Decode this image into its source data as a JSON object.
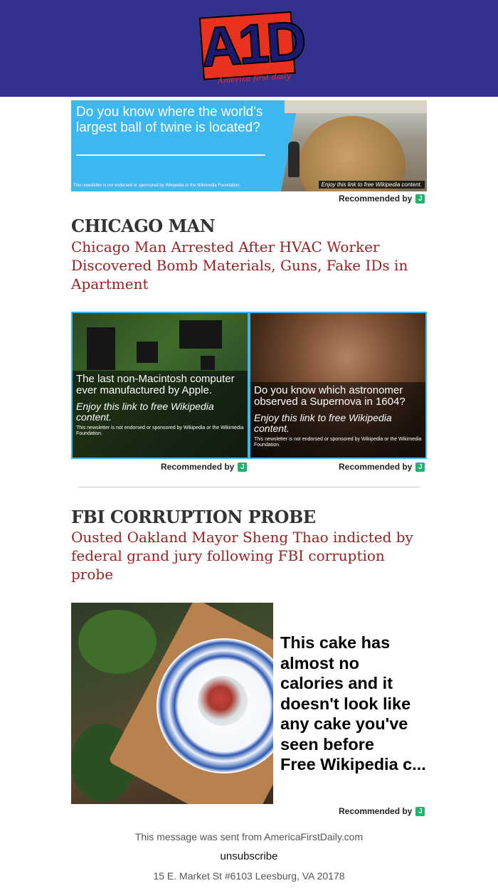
{
  "header": {
    "logo_text": "A1D",
    "logo_tagline": "America first daily",
    "background_color": "#33318e",
    "logo_color": "#e8311f"
  },
  "ads": {
    "twine": {
      "question": "Do you know where the world's largest ball of twine is located?",
      "enjoy": "Enjoy this link to free Wikipedia content.",
      "disclaimer": "This newsletter is not endorsed or sponsored by Wikipedia or the Wikimedia Foundation.",
      "recommended": "Recommended by"
    },
    "macintosh": {
      "title": "The last non-Macintosh computer ever manufactured by Apple.",
      "enjoy": "Enjoy this link to free Wikipedia content.",
      "disclaimer": "This newsletter is not endorsed or sponsored by Wikipedia or the Wikimedia Foundation.",
      "recommended": "Recommended by"
    },
    "astronomer": {
      "title": "Do you know which astronomer observed a Supernova in 1604?",
      "enjoy": "Enjoy this link to free Wikipedia content.",
      "disclaimer": "This newsletter is not endorsed or sponsored by Wikipedia or the Wikimedia Foundation.",
      "recommended": "Recommended by"
    },
    "cake": {
      "text": "This cake has almost no calories and it doesn't look like any cake you've seen before",
      "subtext": "Free Wikipedia c...",
      "recommended": "Recommended by"
    },
    "badge_color": "#1db46d",
    "accent_color": "#3db7ef"
  },
  "sections": [
    {
      "title": "CHICAGO MAN",
      "link": "Chicago Man Arrested After HVAC Worker Discovered Bomb Materials, Guns, Fake IDs in Apartment"
    },
    {
      "title": "FBI CORRUPTION PROBE",
      "link": "Ousted Oakland Mayor Sheng Thao indicted by federal grand jury following FBI corruption probe"
    }
  ],
  "link_color": "#9c1e1e",
  "footer": {
    "sent_from": "This message was sent from AmericaFirstDaily.com",
    "unsubscribe": "unsubscribe",
    "address": "15 E. Market St #6103 Leesburg, VA 20178"
  }
}
